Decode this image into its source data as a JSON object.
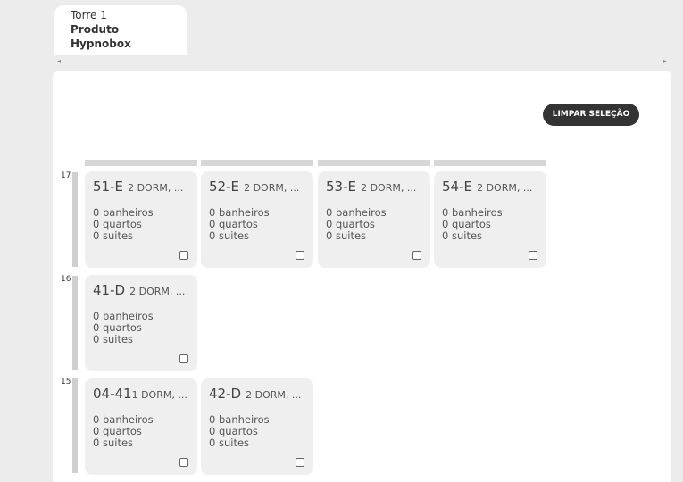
{
  "tab": {
    "tower": "Torre 1",
    "product_line1": "Produto",
    "product_line2": "Hypnobox"
  },
  "scroll": {
    "left_arrow": "◂",
    "right_arrow": "▸"
  },
  "clear_button": "LIMPAR SELEÇÃO",
  "floors": [
    {
      "label": "17",
      "units": [
        {
          "code": "51-E",
          "desc": "2 DORM, ...",
          "banheiros": "0 banheiros",
          "quartos": "0 quartos",
          "suites": "0 suites"
        },
        {
          "code": "52-E",
          "desc": "2 DORM, ...",
          "banheiros": "0 banheiros",
          "quartos": "0 quartos",
          "suites": "0 suites"
        },
        {
          "code": "53-E",
          "desc": "2 DORM, ...",
          "banheiros": "0 banheiros",
          "quartos": "0 quartos",
          "suites": "0 suites"
        },
        {
          "code": "54-E",
          "desc": "2 DORM, ...",
          "banheiros": "0 banheiros",
          "quartos": "0 quartos",
          "suites": "0 suites"
        }
      ]
    },
    {
      "label": "16",
      "units": [
        {
          "code": "41-D",
          "desc": "2 DORM, ...",
          "banheiros": "0 banheiros",
          "quartos": "0 quartos",
          "suites": "0 suites"
        }
      ]
    },
    {
      "label": "15",
      "units": [
        {
          "code": "04-41",
          "desc": "1 DORM, ...",
          "banheiros": "0 banheiros",
          "quartos": "0 quartos",
          "suites": "0 suites"
        },
        {
          "code": "42-D",
          "desc": "2 DORM, ...",
          "banheiros": "0 banheiros",
          "quartos": "0 quartos",
          "suites": "0 suites"
        }
      ]
    }
  ]
}
